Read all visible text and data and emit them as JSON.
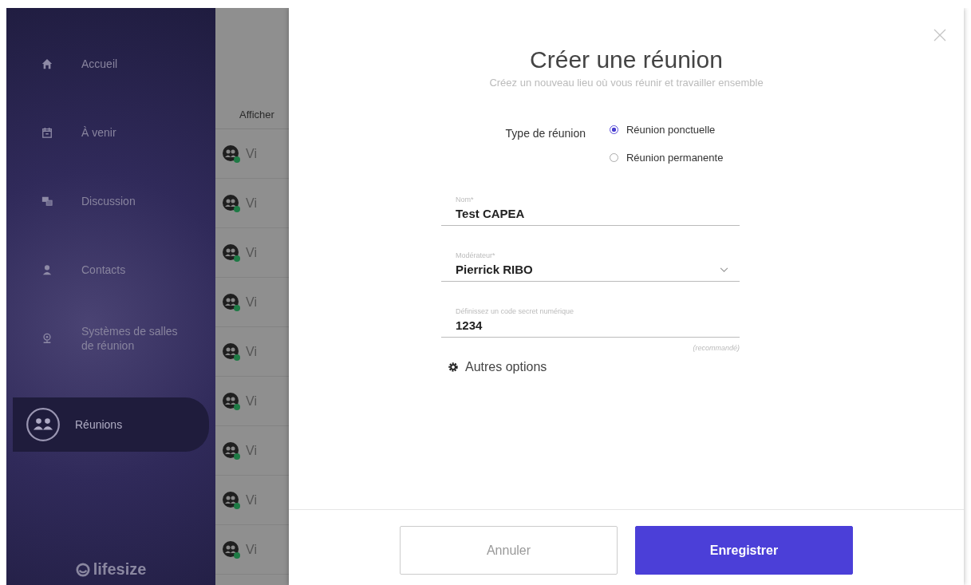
{
  "sidebar": {
    "items": [
      {
        "label": "Accueil",
        "kind": "home",
        "selected": false
      },
      {
        "label": "À venir",
        "kind": "calendar",
        "selected": false
      },
      {
        "label": "Discussion",
        "kind": "chat",
        "selected": false
      },
      {
        "label": "Contacts",
        "kind": "person",
        "selected": false
      },
      {
        "label": "Systèmes de salles de réunion",
        "kind": "room",
        "selected": false
      },
      {
        "label": "Réunions",
        "kind": "group",
        "selected": true
      }
    ],
    "logo": "lifesize"
  },
  "list": {
    "header": "Afficher",
    "rows": [
      {
        "label": "Vi"
      },
      {
        "label": "Vi"
      },
      {
        "label": "Vi"
      },
      {
        "label": "Vi"
      },
      {
        "label": "Vi"
      },
      {
        "label": "Vi"
      },
      {
        "label": "Vi"
      },
      {
        "label": "Vi"
      },
      {
        "label": "Vi"
      }
    ]
  },
  "dialog": {
    "title": "Créer une réunion",
    "subtitle": "Créez un nouveau lieu où vous réunir et travailler ensemble",
    "type_label": "Type de réunion",
    "types": [
      {
        "label": "Réunion ponctuelle",
        "selected": true
      },
      {
        "label": "Réunion permanente",
        "selected": false
      }
    ],
    "fields": [
      {
        "kind": "text",
        "label": "Nom*",
        "value": "Test CAPEA"
      },
      {
        "kind": "select",
        "label": "Modérateur*",
        "value": "Pierrick RIBO"
      },
      {
        "kind": "text",
        "label": "Définissez un code secret numérique",
        "value": "1234",
        "hint": "(recommandé)"
      }
    ],
    "options_link": "Autres options",
    "buttons": [
      {
        "label": "Annuler",
        "kind": "secondary"
      },
      {
        "label": "Enregistrer",
        "kind": "primary"
      }
    ]
  }
}
